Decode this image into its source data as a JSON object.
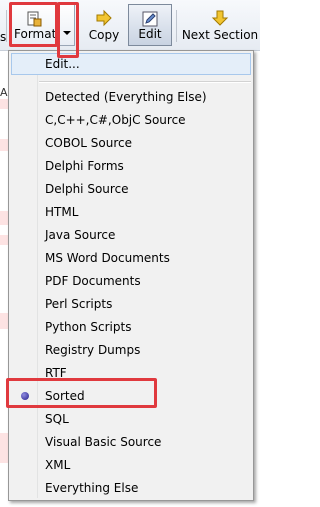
{
  "toolbar": {
    "left_clip": "s",
    "format_label": "Format",
    "copy_label": "Copy",
    "edit_label": "Edit",
    "next_section_label": "Next Section"
  },
  "background": {
    "left_label": "AN",
    "stripe_color": "#fde3e3"
  },
  "menu": {
    "items": [
      {
        "label": "Edit...",
        "state": "hover"
      },
      {
        "label": "Detected (Everything Else)"
      },
      {
        "label": "C,C++,C#,ObjC Source"
      },
      {
        "label": "COBOL Source"
      },
      {
        "label": "Delphi Forms"
      },
      {
        "label": "Delphi Source"
      },
      {
        "label": "HTML"
      },
      {
        "label": "Java Source"
      },
      {
        "label": "MS Word Documents"
      },
      {
        "label": "PDF Documents"
      },
      {
        "label": "Perl Scripts"
      },
      {
        "label": "Python Scripts"
      },
      {
        "label": "Registry Dumps"
      },
      {
        "label": "RTF"
      },
      {
        "label": "Sorted",
        "selected": true
      },
      {
        "label": "SQL"
      },
      {
        "label": "Visual Basic Source"
      },
      {
        "label": "XML"
      },
      {
        "label": "Everything Else"
      }
    ]
  },
  "annotations": {
    "highlight_color": "#e0393e"
  }
}
